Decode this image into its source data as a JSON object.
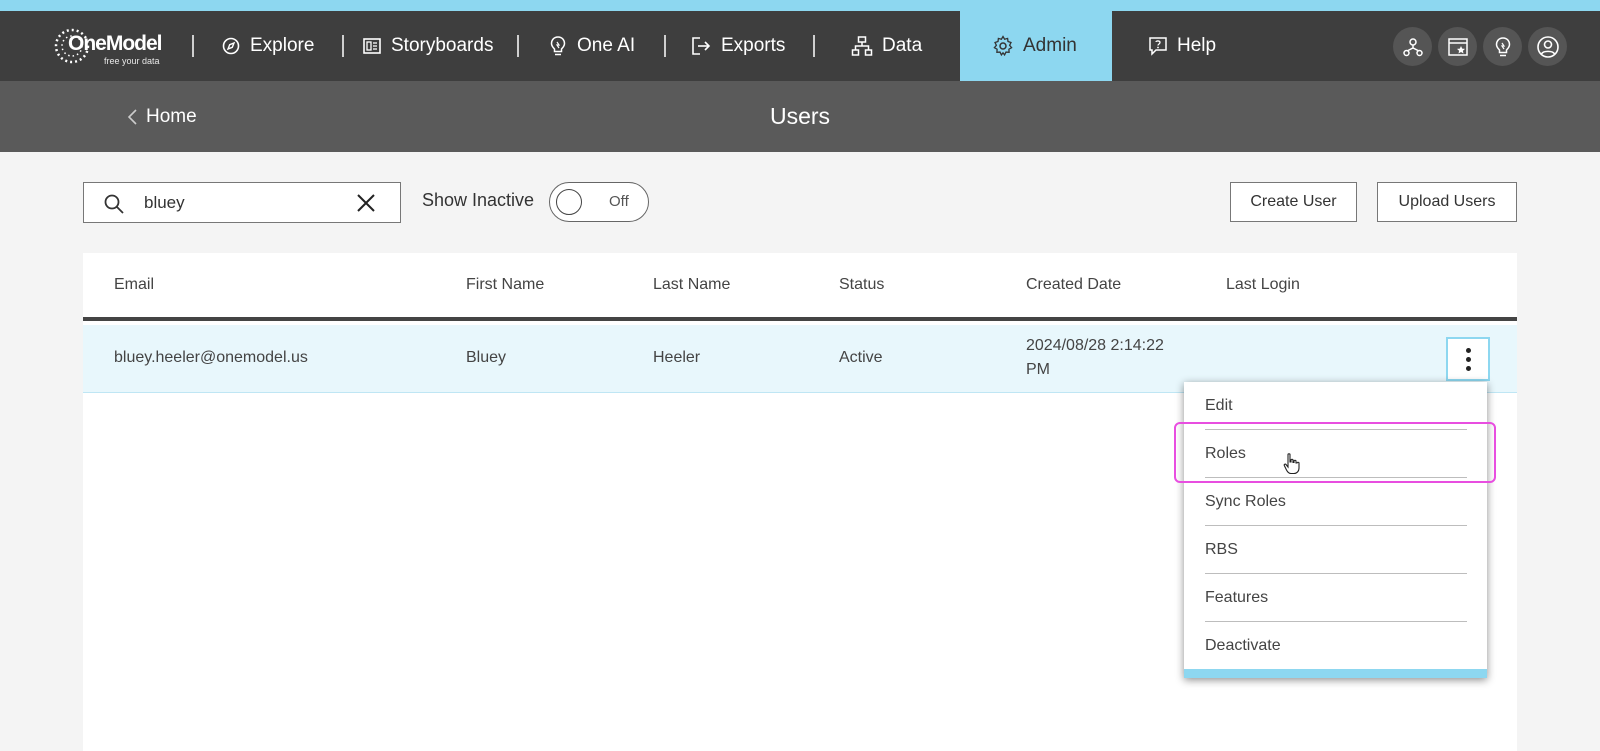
{
  "brand": {
    "name": "OneModel",
    "tagline": "free your data"
  },
  "nav": {
    "items": [
      {
        "label": "Explore",
        "icon": "compass-icon"
      },
      {
        "label": "Storyboards",
        "icon": "storyboard-icon"
      },
      {
        "label": "One AI",
        "icon": "lightbulb-icon"
      },
      {
        "label": "Exports",
        "icon": "export-icon"
      },
      {
        "label": "Data",
        "icon": "hierarchy-icon"
      },
      {
        "label": "Admin",
        "icon": "gear-icon",
        "active": true
      },
      {
        "label": "Help",
        "icon": "help-chat-icon"
      }
    ],
    "utility_icons": [
      "network-icon",
      "dashboard-star-icon",
      "lightbulb-icon",
      "user-account-icon"
    ]
  },
  "subheader": {
    "back_label": "Home",
    "title": "Users"
  },
  "toolbar": {
    "search_value": "bluey",
    "show_inactive_label": "Show Inactive",
    "toggle_state": "Off",
    "create_user_label": "Create User",
    "upload_users_label": "Upload Users"
  },
  "table": {
    "columns": [
      "Email",
      "First Name",
      "Last Name",
      "Status",
      "Created Date",
      "Last Login"
    ],
    "rows": [
      {
        "email": "bluey.heeler@onemodel.us",
        "first_name": "Bluey",
        "last_name": "Heeler",
        "status": "Active",
        "created_date_line1": "2024/08/28 2:14:22",
        "created_date_line2": "PM",
        "last_login": ""
      }
    ]
  },
  "context_menu": {
    "items": [
      "Edit",
      "Roles",
      "Sync Roles",
      "RBS",
      "Features",
      "Deactivate"
    ],
    "highlighted": "Roles"
  },
  "colors": {
    "accent": "#8dd7f0",
    "nav_bg": "#3e3e3e",
    "subheader_bg": "#5a5a5a",
    "highlight": "#e84ee0"
  }
}
